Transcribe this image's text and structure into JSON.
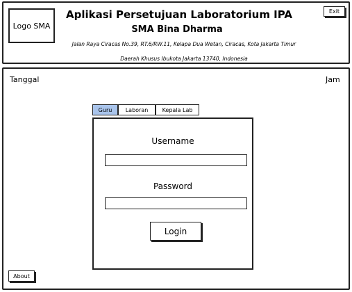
{
  "header": {
    "logo": "Logo SMA",
    "title": "Aplikasi Persetujuan Laboratorium IPA",
    "school": "SMA Bina Dharma",
    "address_line1": "Jalan Raya Ciracas No.39, RT.6/RW.11, Kelapa Dua Wetan, Ciracas, Kota Jakarta Timur",
    "address_line2": "Daerah Khusus Ibukota Jakarta 13740, Indonesia",
    "exit_label": "Exit"
  },
  "main": {
    "date_label": "Tanggal",
    "time_label": "Jam",
    "tabs": [
      {
        "label": "Guru",
        "active": true
      },
      {
        "label": "Laboran",
        "active": false
      },
      {
        "label": "Kepala Lab",
        "active": false
      }
    ],
    "login": {
      "username_label": "Username",
      "username_value": "",
      "password_label": "Password",
      "password_value": "",
      "button_label": "Login"
    },
    "about_label": "About"
  },
  "colors": {
    "active_tab": "#a9c4eb",
    "border": "#222222"
  }
}
